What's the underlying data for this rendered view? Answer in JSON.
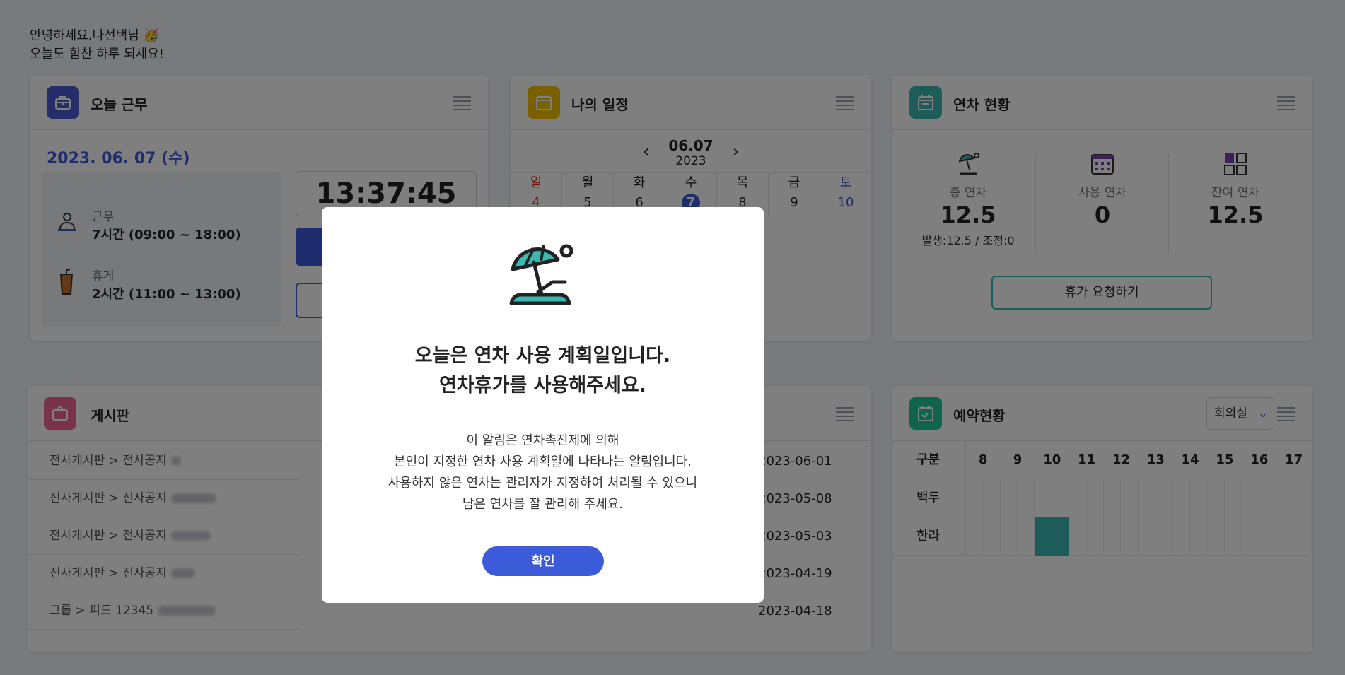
{
  "greeting": {
    "line1": "안녕하세요.나선택님",
    "line2": "오늘도 힘찬 하루 되세요!",
    "emoji": "🥳"
  },
  "work_card": {
    "title": "오늘 근무",
    "date": "2023. 06. 07 (수)",
    "work_label": "근무",
    "work_value": "7시간 (09:00 ~ 18:00)",
    "break_label": "휴게",
    "break_value": "2시간 (11:00 ~ 13:00)",
    "clock": "13:37:45"
  },
  "schedule_card": {
    "title": "나의 일정",
    "month_day": "06.07",
    "year": "2023",
    "days": [
      {
        "name": "일",
        "num": "4"
      },
      {
        "name": "월",
        "num": "5"
      },
      {
        "name": "화",
        "num": "6"
      },
      {
        "name": "수",
        "num": "7"
      },
      {
        "name": "목",
        "num": "8"
      },
      {
        "name": "금",
        "num": "9"
      },
      {
        "name": "토",
        "num": "10"
      }
    ]
  },
  "leave_card": {
    "title": "연차 현황",
    "total_label": "총 연차",
    "total_value": "12.5",
    "total_detail": "발생:12.5 / 조정:0",
    "used_label": "사용 연차",
    "used_value": "0",
    "remain_label": "잔여 연차",
    "remain_value": "12.5",
    "request_button": "휴가 요청하기"
  },
  "board_card": {
    "title": "게시판",
    "rows": [
      {
        "path": "전사게시판 > 전사공지"
      },
      {
        "path": "전사게시판 > 전사공지"
      },
      {
        "path": "전사게시판 > 전사공지"
      },
      {
        "path": "전사게시판 > 전사공지"
      },
      {
        "path": "그룹 > 피드 12345"
      }
    ],
    "dates": [
      "2023-06-01",
      "2023-05-08",
      "2023-05-03",
      "2023-04-19",
      "2023-04-18"
    ]
  },
  "reservation_card": {
    "title": "예약현황",
    "select_value": "회의실",
    "header_label": "구분",
    "hours": [
      "8",
      "9",
      "10",
      "11",
      "12",
      "13",
      "14",
      "15",
      "16",
      "17"
    ],
    "rooms": [
      "백두",
      "한라"
    ]
  },
  "modal": {
    "title_line1": "오늘은 연차 사용 계획일입니다.",
    "title_line2": "연차휴가를 사용해주세요.",
    "body_line1": "이 알림은 연차촉진제에 의해",
    "body_line2": "본인이 지정한 연차 사용 계획일에 나타나는 알림입니다.",
    "body_line3": "사용하지 않은 연차는 관리자가 지정하여 처리될 수 있으니",
    "body_line4": "남은 연차를 잘 관리해 주세요.",
    "confirm_button": "확인"
  },
  "colors": {
    "primary": "#3b5bdb",
    "teal": "#3bb8b0",
    "work_icon": "#4a5bd4",
    "schedule_icon": "#f2c200",
    "leave_icon": "#3bb8b0",
    "board_icon": "#f06595",
    "reserve_icon": "#20c997"
  }
}
